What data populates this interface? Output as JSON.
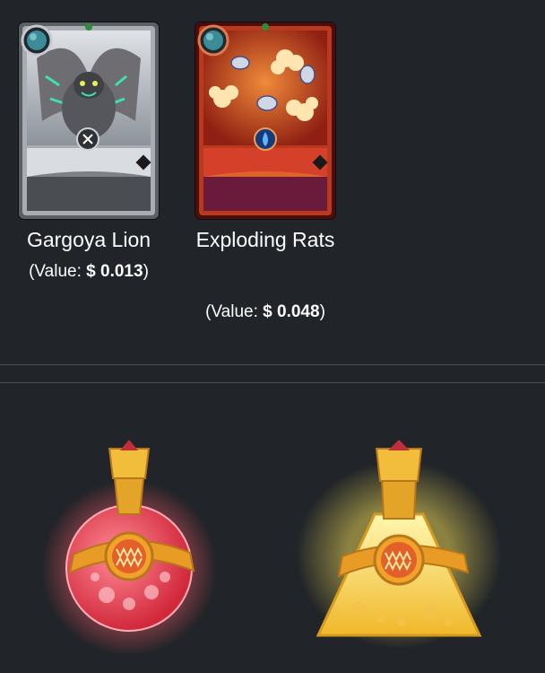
{
  "cards": [
    {
      "name": "Gargoya Lion",
      "value_prefix": "(Value: ",
      "value_amount": "$ 0.013",
      "value_suffix": ")",
      "frame_color": "#b9bcc1",
      "icon": "gargoyle-art-icon"
    },
    {
      "name": "Exploding Rats",
      "value_prefix": "(Value: ",
      "value_amount": "$ 0.048",
      "value_suffix": ")",
      "frame_color": "#c2401e",
      "icon": "rats-art-icon"
    }
  ],
  "potions": [
    {
      "icon": "red-potion-icon",
      "glow_color": "#ff5a6a"
    },
    {
      "icon": "gold-potion-icon",
      "glow_color": "#f5e05a"
    }
  ],
  "colors": {
    "background": "#212428",
    "divider": "#4a4f55",
    "text": "#ffffff"
  }
}
